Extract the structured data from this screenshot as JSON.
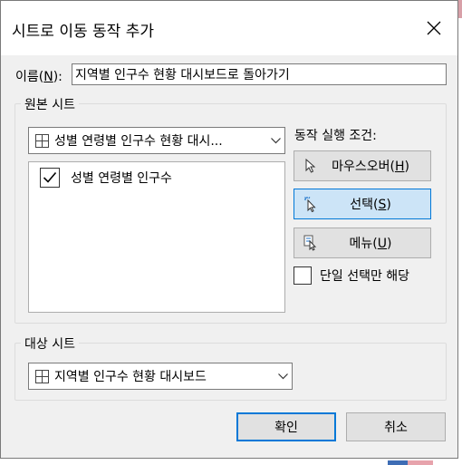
{
  "dialog": {
    "title": "시트로 이동 동작 추가",
    "close_icon": "close-icon"
  },
  "name": {
    "label_prefix": "이름(",
    "label_hotkey": "N",
    "label_suffix": "):",
    "value": "지역별 인구수 현황 대시보드로 돌아가기"
  },
  "source": {
    "group_title": "원본 시트",
    "combo_value": "성별 연령별 인구수 현황 대시...",
    "items": [
      {
        "label": "성별 연령별 인구수",
        "checked": true
      }
    ]
  },
  "run_condition": {
    "label": "동작 실행 조건:",
    "options": [
      {
        "label": "마우스오버",
        "hotkey": "H",
        "icon": "pointer-arrow-icon",
        "selected": false
      },
      {
        "label": "선택",
        "hotkey": "S",
        "icon": "click-pointer-icon",
        "selected": true
      },
      {
        "label": "메뉴",
        "hotkey": "U",
        "icon": "menu-pointer-icon",
        "selected": false
      }
    ],
    "single_select_label": "단일 선택만 해당",
    "single_select_checked": false
  },
  "target": {
    "group_title": "대상 시트",
    "combo_value": "지역별 인구수 현황 대시보드"
  },
  "buttons": {
    "ok": "확인",
    "cancel": "취소"
  },
  "colors": {
    "selected_bg": "#cce4f7",
    "accent": "#0078d7",
    "dialog_bg": "#f0f0f0"
  }
}
